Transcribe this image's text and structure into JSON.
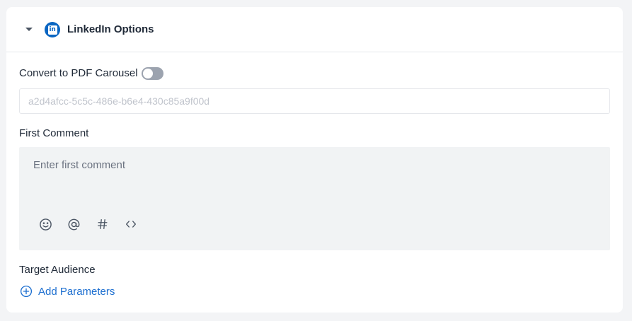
{
  "header": {
    "title": "LinkedIn Options",
    "icon": "linkedin-icon",
    "brand_color": "#0a66c2",
    "icon_text": "in"
  },
  "carousel": {
    "label": "Convert to PDF Carousel",
    "enabled": false
  },
  "id_field": {
    "placeholder": "a2d4afcc-5c5c-486e-b6e4-430c85a9f00d"
  },
  "first_comment": {
    "label": "First Comment",
    "placeholder": "Enter first comment",
    "value": "",
    "toolbar": [
      "emoji-icon",
      "mention-icon",
      "hashtag-icon",
      "code-icon"
    ]
  },
  "target_audience": {
    "label": "Target Audience",
    "add_label": "Add Parameters",
    "accent": "#1d6fd0"
  }
}
